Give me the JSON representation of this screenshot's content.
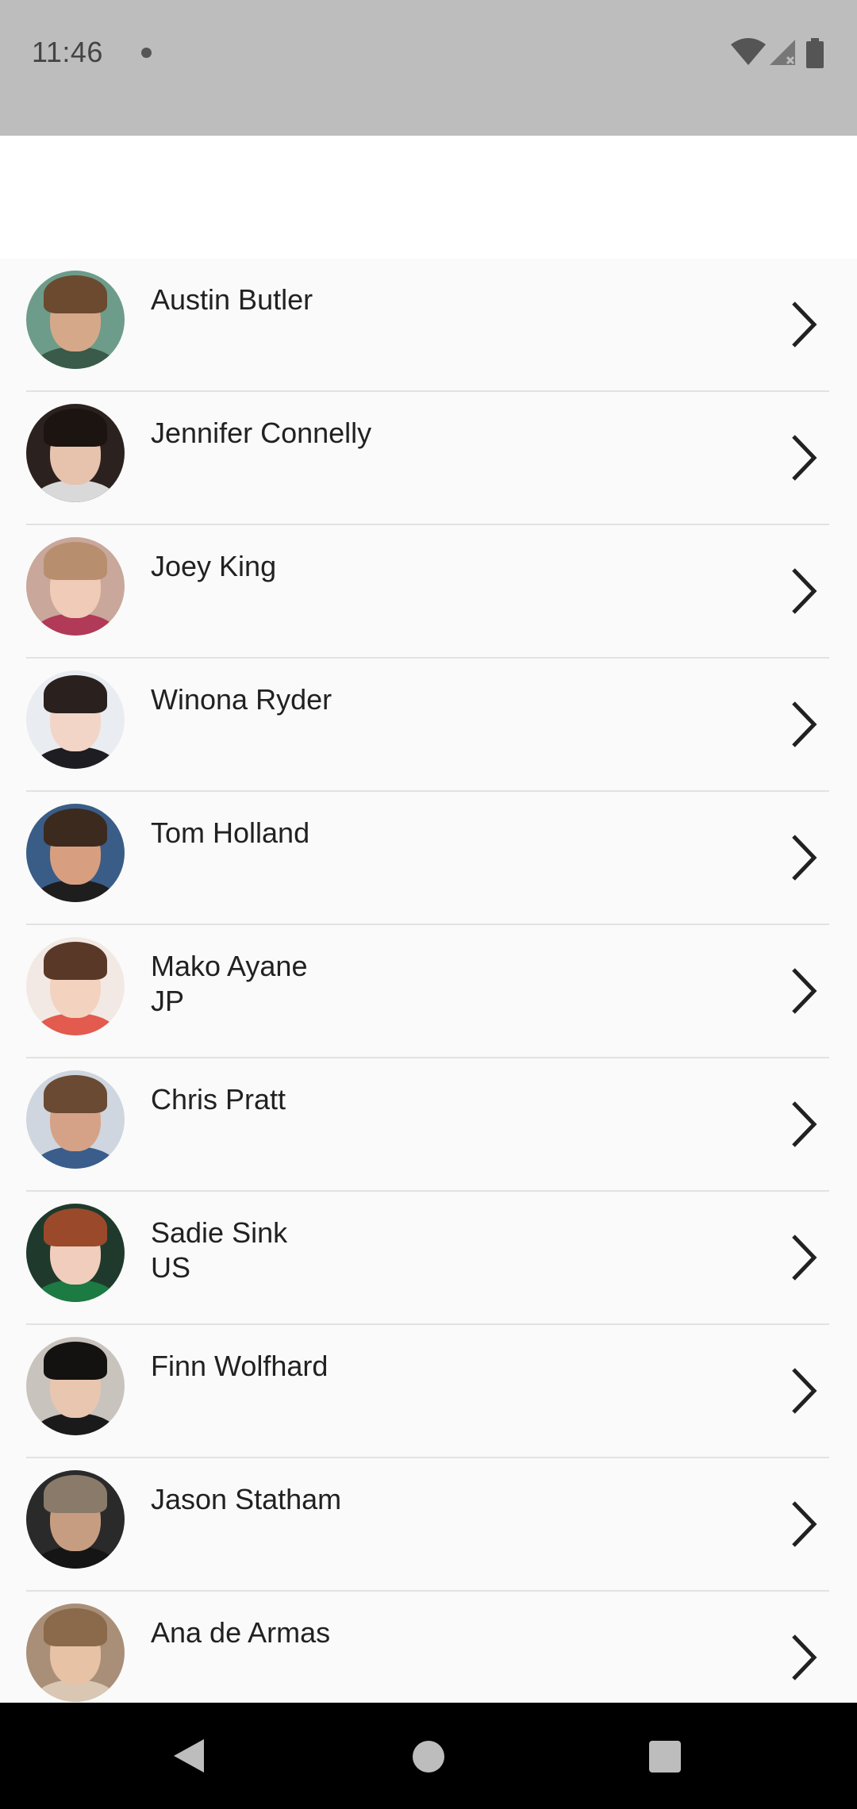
{
  "status_bar": {
    "time": "11:46",
    "icons": [
      "notification-dot-icon",
      "wifi-icon",
      "cell-signal-icon",
      "battery-icon"
    ]
  },
  "app_bar": {
    "title": ""
  },
  "people": [
    {
      "name": "Austin Butler",
      "subtitle": "",
      "avatar_colors": {
        "bg": "#6d9c8a",
        "hair": "#6b4a2f",
        "face": "#d6a88a",
        "body": "#3a5a4a"
      }
    },
    {
      "name": "Jennifer Connelly",
      "subtitle": "",
      "avatar_colors": {
        "bg": "#2b2220",
        "hair": "#1c1411",
        "face": "#e7c2ad",
        "body": "#d9d9d9"
      }
    },
    {
      "name": "Joey King",
      "subtitle": "",
      "avatar_colors": {
        "bg": "#c9a79b",
        "hair": "#b88f6e",
        "face": "#f0cbb7",
        "body": "#b03a57"
      }
    },
    {
      "name": "Winona Ryder",
      "subtitle": "",
      "avatar_colors": {
        "bg": "#e9ecf0",
        "hair": "#2a211e",
        "face": "#f2d5c6",
        "body": "#1d1d22"
      }
    },
    {
      "name": "Tom Holland",
      "subtitle": "",
      "avatar_colors": {
        "bg": "#3a5d87",
        "hair": "#3d2a1e",
        "face": "#d79f80",
        "body": "#1e1e1e"
      }
    },
    {
      "name": "Mako Ayane",
      "subtitle": "JP",
      "avatar_colors": {
        "bg": "#f3e9e4",
        "hair": "#5a3827",
        "face": "#f3d2c0",
        "body": "#e35a4e"
      }
    },
    {
      "name": "Chris Pratt",
      "subtitle": "",
      "avatar_colors": {
        "bg": "#cfd6df",
        "hair": "#6a4a33",
        "face": "#d6a287",
        "body": "#3b5d8c"
      }
    },
    {
      "name": "Sadie Sink",
      "subtitle": "US",
      "avatar_colors": {
        "bg": "#1f3a2c",
        "hair": "#9a4a2a",
        "face": "#f0cdbc",
        "body": "#1c7a43"
      }
    },
    {
      "name": "Finn Wolfhard",
      "subtitle": "",
      "avatar_colors": {
        "bg": "#c9c3be",
        "hair": "#141211",
        "face": "#e9c6b0",
        "body": "#1a1a1a"
      }
    },
    {
      "name": "Jason Statham",
      "subtitle": "",
      "avatar_colors": {
        "bg": "#2a2a2a",
        "hair": "#8a7a6a",
        "face": "#c79d82",
        "body": "#151515"
      }
    },
    {
      "name": "Ana de Armas",
      "subtitle": "",
      "avatar_colors": {
        "bg": "#a98f78",
        "hair": "#8a6a4a",
        "face": "#e7c2a4",
        "body": "#d9c7b4"
      }
    }
  ],
  "row_icon": "chevron-right-icon",
  "nav_bar": {
    "buttons": [
      "back-icon",
      "home-icon",
      "recents-icon"
    ]
  }
}
